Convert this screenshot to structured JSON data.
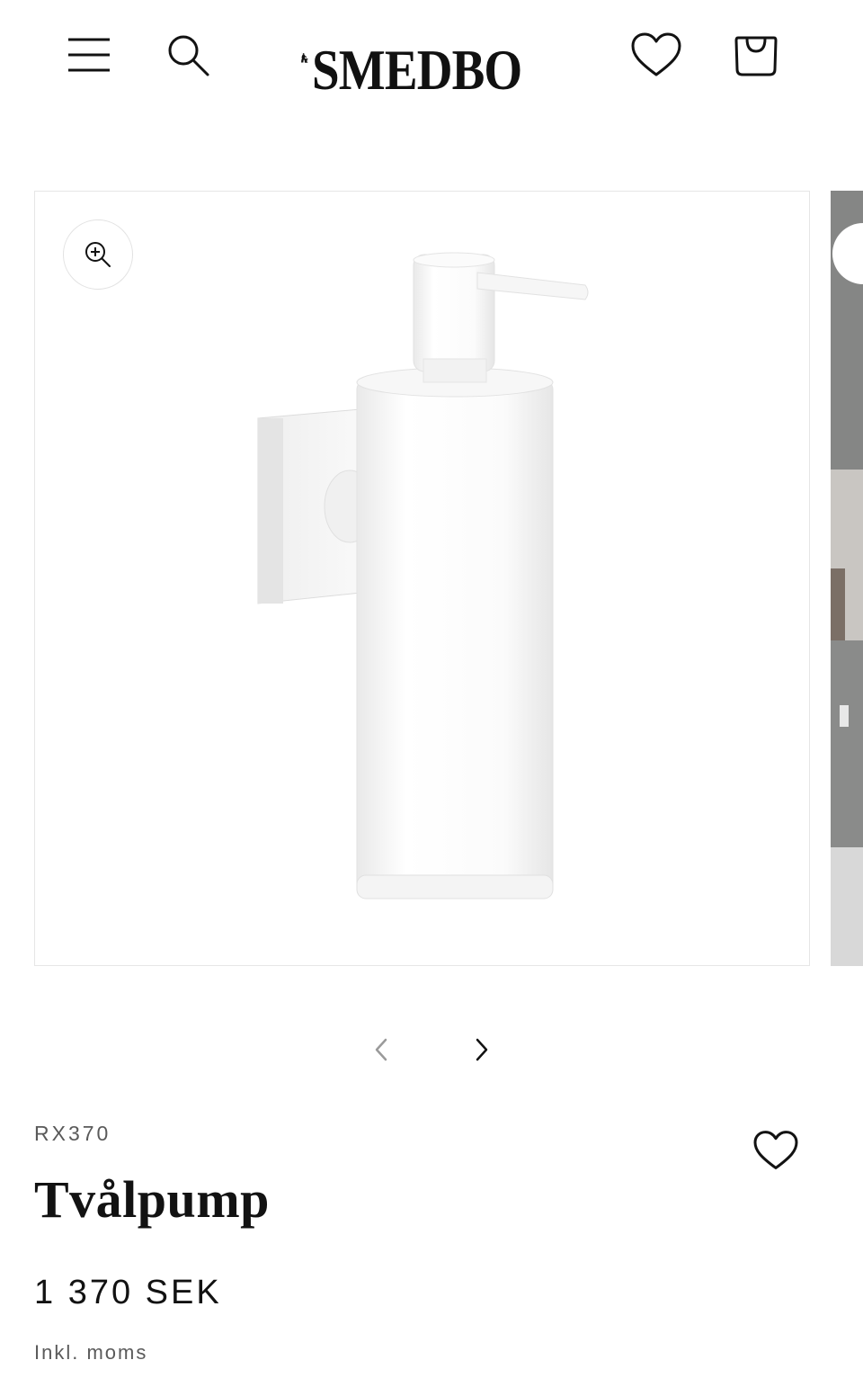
{
  "header": {
    "logo_text": "SMEDBO",
    "logo_registered": "®",
    "icons": {
      "menu": "hamburger-menu-icon",
      "search": "search-icon",
      "wishlist": "heart-icon",
      "cart": "shopping-bag-icon"
    }
  },
  "gallery": {
    "zoom_icon": "zoom-in-icon",
    "prev_icon": "chevron-left-icon",
    "next_icon": "chevron-right-icon"
  },
  "product": {
    "sku": "RX370",
    "title": "Tvålpump",
    "price": "1 370 SEK",
    "tax_note": "Inkl. moms",
    "favorite_icon": "heart-icon"
  },
  "colors": {
    "text": "#121212",
    "muted": "#5a5a5a",
    "border": "#e6e6e6",
    "background": "#ffffff"
  }
}
